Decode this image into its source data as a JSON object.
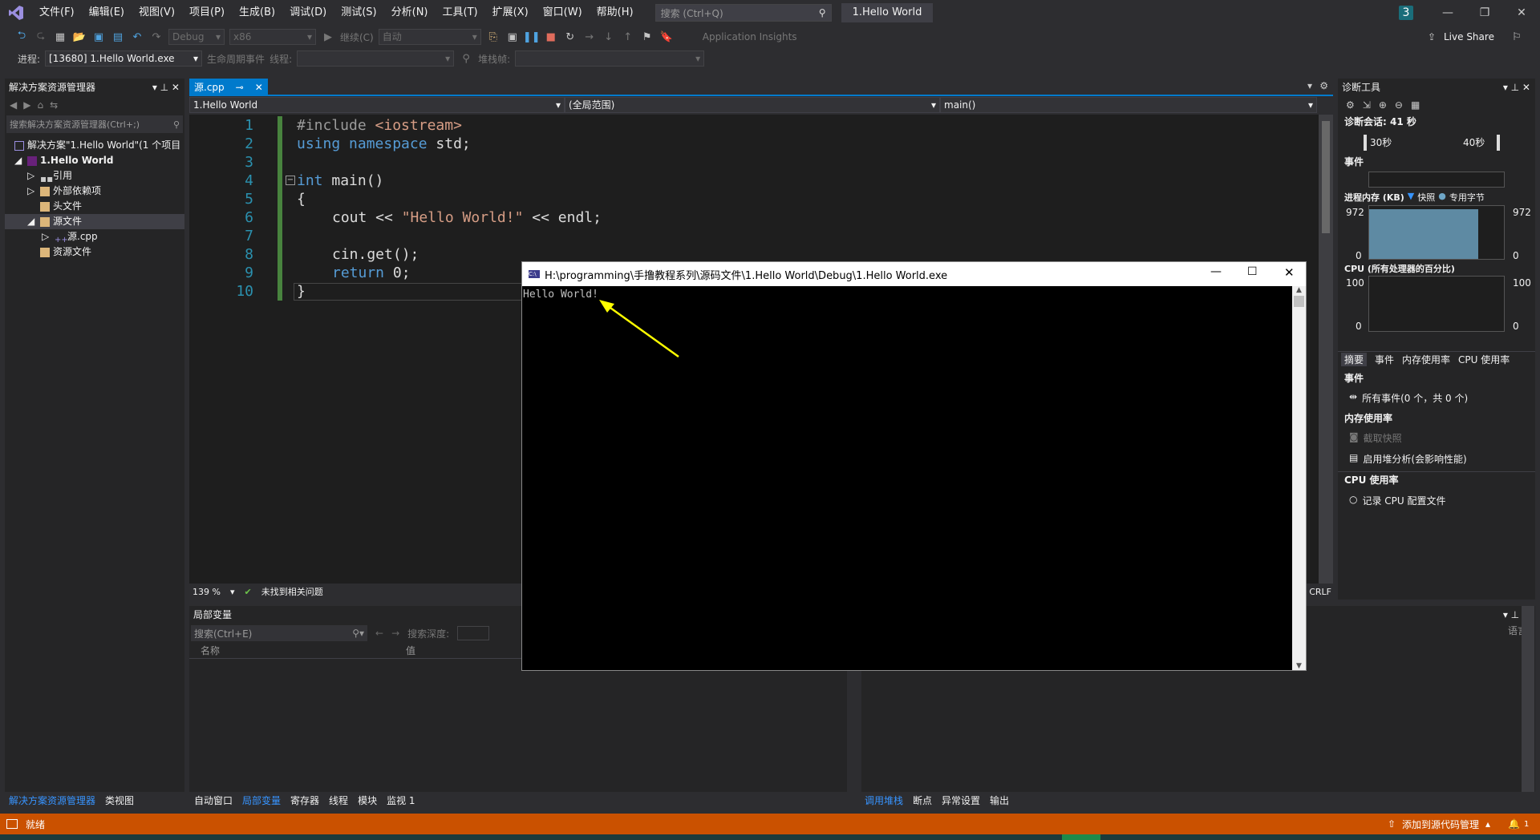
{
  "titlebar": {
    "menus": [
      "文件(F)",
      "编辑(E)",
      "视图(V)",
      "项目(P)",
      "生成(B)",
      "调试(D)",
      "测试(S)",
      "分析(N)",
      "工具(T)",
      "扩展(X)",
      "窗口(W)",
      "帮助(H)"
    ],
    "search_placeholder": "搜索 (Ctrl+Q)",
    "window_title": "1.Hello World",
    "notification_count": "3"
  },
  "toolbar": {
    "config": "Debug",
    "platform": "x86",
    "continue_label": "继续(C)",
    "auto_label": "自动",
    "app_insights": "Application Insights",
    "live_share": "Live Share",
    "process_label": "进程:",
    "process_value": "[13680] 1.Hello World.exe",
    "lifecycle_label": "生命周期事件",
    "thread_label": "线程:",
    "stackframe_label": "堆栈帧:"
  },
  "solution_explorer": {
    "title": "解决方案资源管理器",
    "search_placeholder": "搜索解决方案资源管理器(Ctrl+;)",
    "solution": "解决方案\"1.Hello World\"(1 个项目",
    "project": "1.Hello World",
    "items": [
      "引用",
      "外部依赖项",
      "头文件",
      "源文件",
      "源.cpp",
      "资源文件"
    ],
    "tab_active": "解决方案资源管理器",
    "tab_other": "类视图"
  },
  "editor": {
    "tab_name": "源.cpp",
    "nav_project": "1.Hello World",
    "nav_scope": "(全局范围)",
    "nav_member": "main()",
    "zoom": "139 %",
    "issues": "未找到相关问题",
    "line_ending": "CRLF",
    "line_numbers": [
      "1",
      "2",
      "3",
      "4",
      "5",
      "6",
      "7",
      "8",
      "9",
      "10"
    ]
  },
  "console": {
    "title": "H:\\programming\\手撸教程系列\\源码文件\\1.Hello World\\Debug\\1.Hello World.exe",
    "output": "Hello World!"
  },
  "locals": {
    "title": "局部变量",
    "search_placeholder": "搜索(Ctrl+E)",
    "depth_label": "搜索深度:",
    "col_name": "名称",
    "col_value": "值",
    "tabs": [
      "自动窗口",
      "局部变量",
      "寄存器",
      "线程",
      "模块",
      "监视 1"
    ]
  },
  "callstack": {
    "lang_label": "语言",
    "tabs": [
      "调用堆栈",
      "断点",
      "异常设置",
      "输出"
    ]
  },
  "diagnostics": {
    "title": "诊断工具",
    "session": "诊断会话: 41 秒",
    "t30": "30秒",
    "t40": "40秒",
    "events_label": "事件",
    "memory_label": "进程内存 (KB)",
    "snapshot_label": "快照",
    "private_label": "专用字节",
    "mem_max": "972",
    "mem_min": "0",
    "cpu_label": "CPU (所有处理器的百分比)",
    "cpu_max": "100",
    "cpu_min": "0",
    "tabs": [
      "摘要",
      "事件",
      "内存使用率",
      "CPU 使用率"
    ],
    "sec_events": "事件",
    "all_events": "所有事件(0 个，共 0 个)",
    "sec_memory": "内存使用率",
    "take_snapshot": "截取快照",
    "heap_analysis": "启用堆分析(会影响性能)",
    "sec_cpu": "CPU 使用率",
    "record_cpu": "记录 CPU 配置文件"
  },
  "statusbar": {
    "ready": "就绪",
    "source_control": "添加到源代码管理",
    "notif": "1"
  },
  "colors": {
    "accent": "#007acc",
    "status_bar": "#ca5100",
    "arrow": "#ffff00"
  }
}
